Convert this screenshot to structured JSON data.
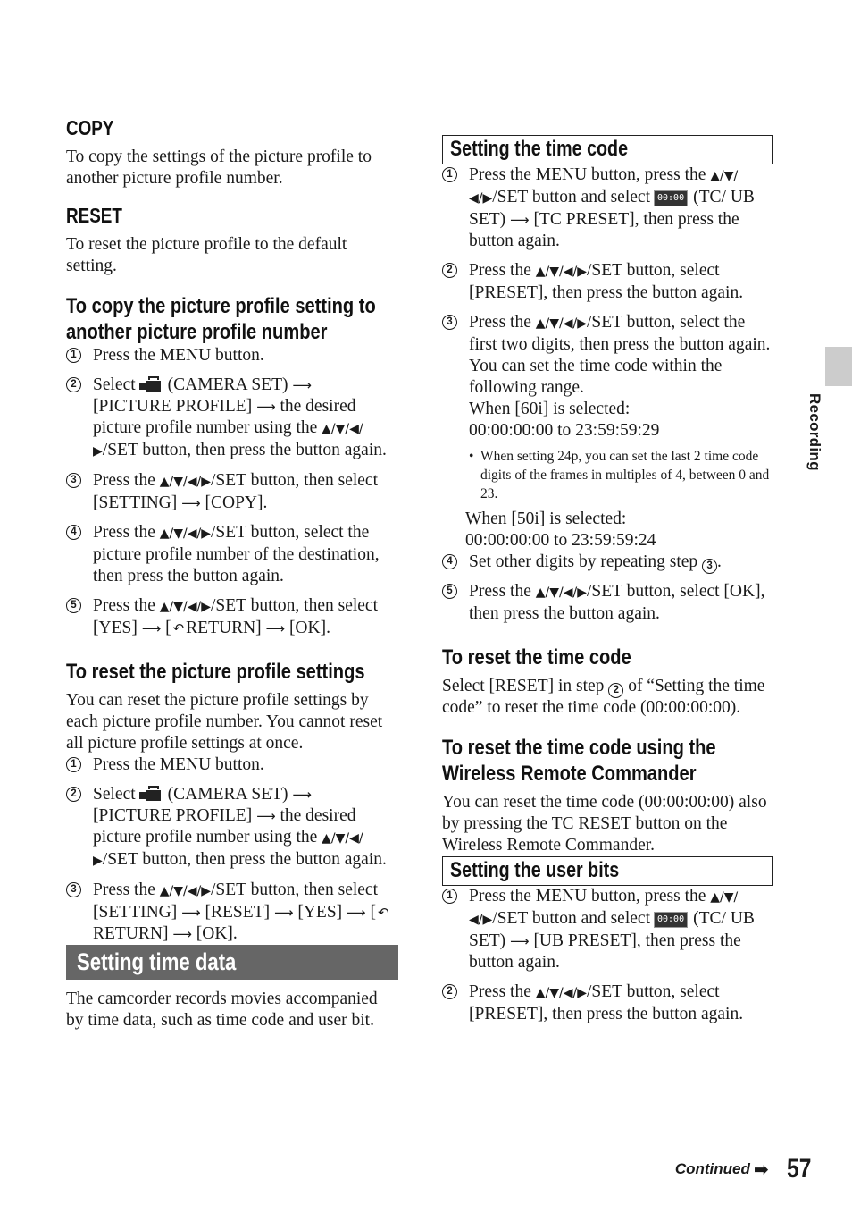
{
  "icons": {
    "dpad_full": "▲/▼/◀/▶",
    "dpad_up_down": "▲/▼/",
    "dpad_left": "◀/",
    "dpad_right": "▶",
    "dpad_udl": "▲/▼/◀/",
    "dpad_lr": "◀/▶",
    "arrow": "⟶",
    "return_glyph": "↶",
    "tc_icon_label": "00:00",
    "circled": [
      "1",
      "2",
      "3",
      "4",
      "5"
    ]
  },
  "left": {
    "copy": {
      "heading": "COPY",
      "text": "To copy the settings of the picture profile to another picture profile number."
    },
    "reset": {
      "heading": "RESET",
      "text": "To reset the picture profile to the default setting."
    },
    "copy_section": {
      "heading": "To copy the picture profile setting to another picture profile number",
      "steps": [
        {
          "text": "Press the MENU button."
        },
        {
          "pre": "Select",
          "post": "(CAMERA SET)",
          "line2": "[PICTURE PROFILE]",
          "line2b": "the desired picture profile number using the",
          "line3": "/SET button, then press the button again."
        },
        {
          "pre": "Press the",
          "post": "/SET button, then select [SETTING]",
          "end": "[COPY]."
        },
        {
          "pre": "Press the",
          "post": "/SET button, select the picture profile number of the destination, then press the button again."
        },
        {
          "pre": "Press the",
          "post": "/SET button, then select [YES]",
          "mid": "[",
          "ret": "RETURN]",
          "end": "[OK]."
        }
      ]
    },
    "reset_section": {
      "heading": "To reset the picture profile settings",
      "text": "You can reset the picture profile settings by each picture profile number. You cannot reset all picture profile settings at once.",
      "steps": [
        {
          "text": "Press the MENU button."
        },
        {
          "pre": "Select",
          "post": "(CAMERA SET)",
          "line2": "[PICTURE PROFILE]",
          "line2b": "the desired picture profile number using the",
          "line3": "/SET button, then press the button again."
        },
        {
          "pre": "Press the",
          "post": "/SET button, then select [SETTING]",
          "a": "[RESET]",
          "b": "[YES]",
          "mid": "[",
          "ret": "RETURN]",
          "end": "[OK]."
        }
      ]
    },
    "time_data": {
      "heading": "Setting time data",
      "text": "The camcorder records movies accompanied by time data, such as time code and user bit."
    }
  },
  "right": {
    "time_code": {
      "heading": "Setting the time code",
      "steps": [
        {
          "pre": "Press the MENU button, press the",
          "mid": "/SET button and select",
          "post": "(TC/ UB SET)",
          "end": "[TC PRESET], then press the button again."
        },
        {
          "pre": "Press the",
          "post": "/SET button, select [PRESET], then press the button again."
        },
        {
          "pre": "Press the",
          "post": "/SET button, select the first two digits, then press the button again. You can set the time code within the following range.",
          "range60_label": "When [60i] is selected:",
          "range60": "00:00:00:00 to 23:59:59:29",
          "note": "When setting 24p, you can set the last 2 time code digits of the frames in multiples of 4, between 0 and 23.",
          "range50_label": "When [50i] is selected:",
          "range50": "00:00:00:00 to 23:59:59:24"
        },
        {
          "pre": "Set other digits by repeating step",
          "end": "."
        },
        {
          "pre": "Press the",
          "post": "/SET button, select [OK], then press the button again."
        }
      ]
    },
    "reset_tc": {
      "heading": "To reset the time code",
      "pre": "Select [RESET] in step",
      "post": "of “Setting the time code” to reset the time code (00:00:00:00)."
    },
    "reset_tc_remote": {
      "heading": "To reset the time code using the Wireless Remote Commander",
      "text": "You can reset the time code (00:00:00:00) also by pressing the TC RESET button on the Wireless Remote Commander."
    },
    "user_bits": {
      "heading": "Setting the user bits",
      "steps": [
        {
          "pre": "Press the MENU button, press the",
          "mid": "/SET button and select",
          "post": "(TC/ UB SET)",
          "end": "[UB PRESET], then press the button again."
        },
        {
          "pre": "Press the",
          "post": "/SET button, select [PRESET], then press the button again."
        }
      ]
    }
  },
  "side_tab": {
    "label": "Recording"
  },
  "footer": {
    "continued": "Continued",
    "arrow": "➡",
    "page_number": "57"
  },
  "colors": {
    "section_bar": "#666666",
    "side_tab": "#cccccc",
    "text": "#1a1a1a"
  }
}
